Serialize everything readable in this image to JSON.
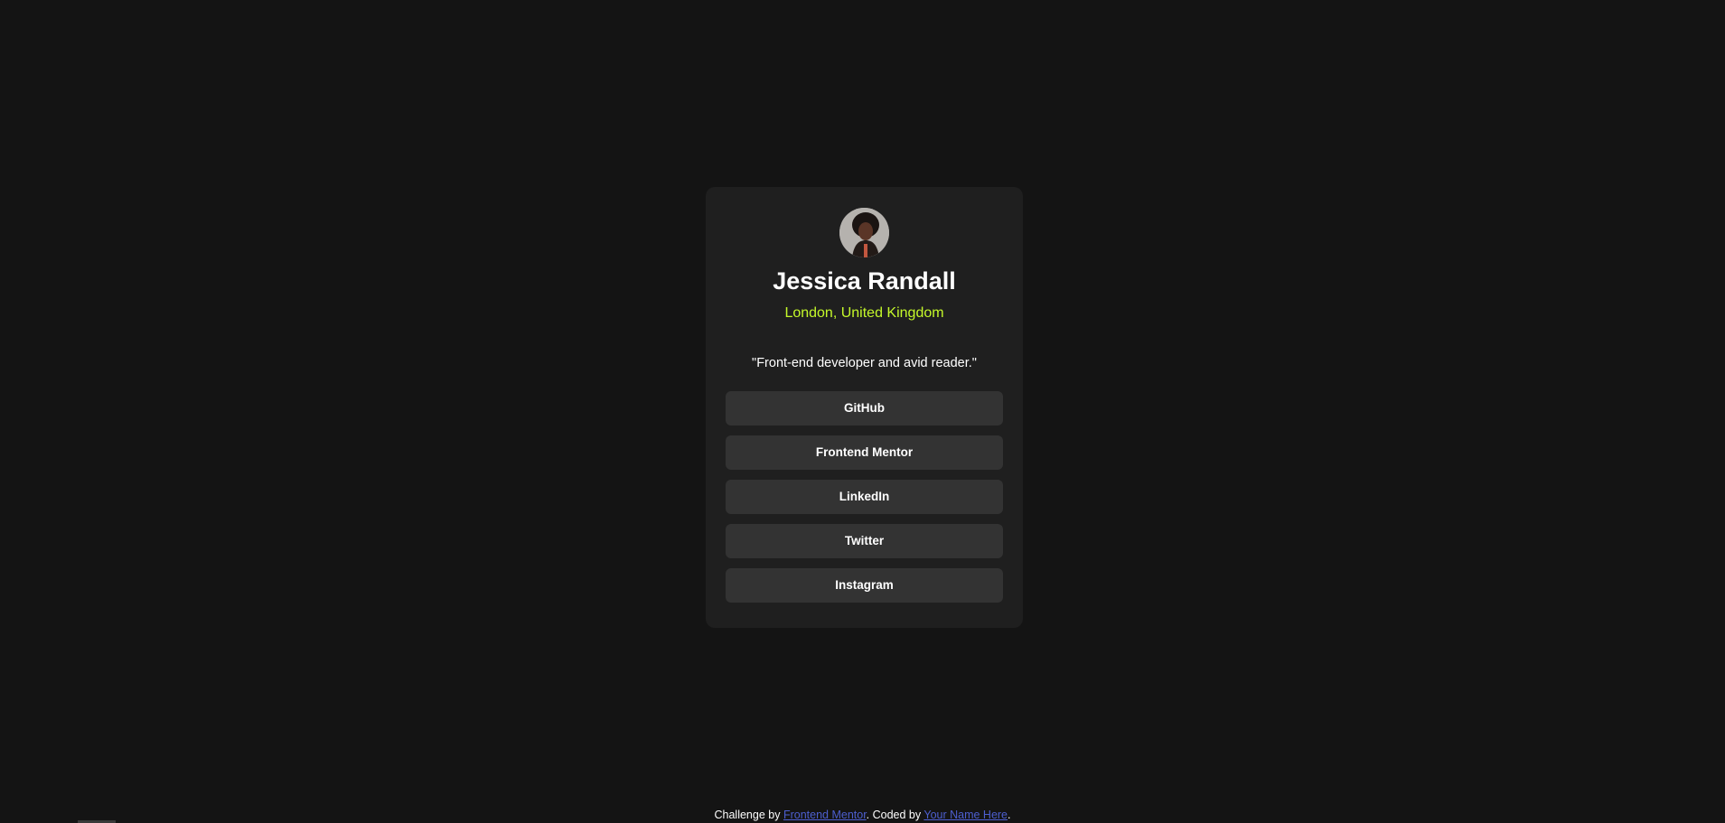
{
  "profile": {
    "name": "Jessica Randall",
    "location": "London, United Kingdom",
    "bio": "\"Front-end developer and avid reader.\"",
    "avatar_alt": "Jessica Randall",
    "accent_color": "#c4f82a"
  },
  "links": [
    {
      "label": "GitHub"
    },
    {
      "label": "Frontend Mentor"
    },
    {
      "label": "LinkedIn"
    },
    {
      "label": "Twitter"
    },
    {
      "label": "Instagram"
    }
  ],
  "footer": {
    "prefix": "Challenge by ",
    "challenge_link": "Frontend Mentor",
    "middle": ". Coded by ",
    "author_link": "Your Name Here",
    "suffix": ".",
    "link_color": "#4d5fd0"
  },
  "colors": {
    "background": "#141414",
    "card": "#1f1f1f",
    "button": "#333333"
  }
}
